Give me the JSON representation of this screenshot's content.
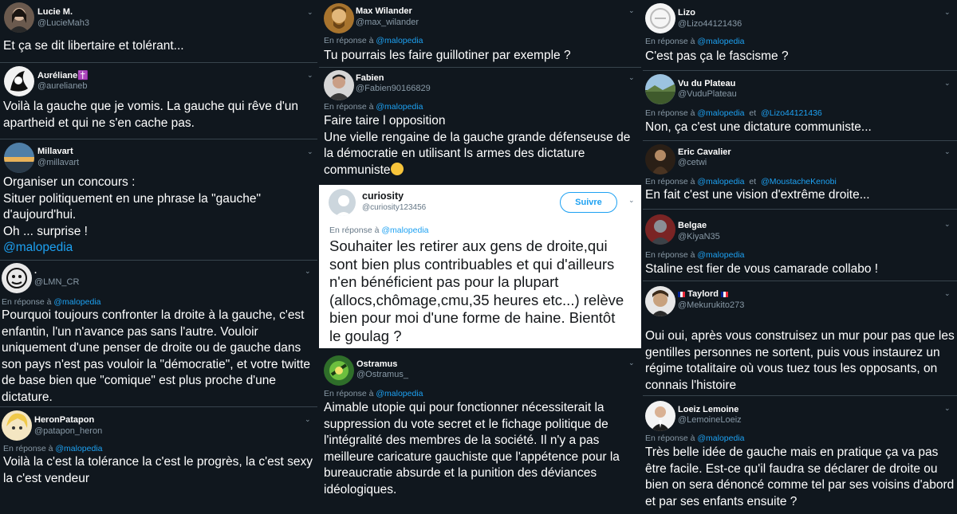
{
  "tweets": {
    "lucie": {
      "name": "Lucie M.",
      "handle": "@LucieMah3",
      "text": "Et ça se dit libertaire et tolérant..."
    },
    "aureliane": {
      "name": "Aʊréliane✝️",
      "handle": "@aurelianeb",
      "text": "Voilà la gauche que je vomis. La gauche qui rêve d'un apartheid et qui ne s'en cache pas."
    },
    "millavart": {
      "name": "Millavart",
      "handle": "@millavart",
      "lines": [
        "Organiser un concours :",
        "Situer politiquement en une phrase la \"gauche\"",
        "d'aujourd'hui.",
        "Oh ... surprise !"
      ],
      "link": "@malopedia"
    },
    "lmn": {
      "name": ".",
      "handle": "@LMN_CR",
      "reply_prefix": "En réponse à",
      "reply_mention": "@malopedia",
      "text": "Pourquoi toujours confronter la droite à la gauche, c'est enfantin, l'un n'avance pas sans l'autre. Vouloir uniquement d'une penser de droite ou de gauche dans son pays n'est pas vouloir la \"démocratie\", et votre twitte de base bien que \"comique\" est plus proche d'une dictature."
    },
    "heron": {
      "name": "HeronPatapon",
      "handle": "@patapon_heron",
      "reply_prefix": "En réponse à",
      "reply_mention": "@malopedia",
      "text": "Voilà la c'est la tolérance la c'est le progrès, la c'est sexy la c'est vendeur"
    },
    "max": {
      "name": "Max Wilander",
      "handle": "@max_wilander",
      "reply_prefix": "En réponse à",
      "reply_mention": "@malopedia",
      "text": "Tu pourrais les faire guillotiner par exemple ?"
    },
    "fabien": {
      "name": "Fabien",
      "handle": "@Fabien90166829",
      "reply_prefix": "En réponse à",
      "reply_mention": "@malopedia",
      "lines": [
        "Faire taire l opposition",
        "Une vielle rengaine de la gauche grande défenseuse de la démocratie en utilisant ls armes des dictature communiste"
      ]
    },
    "curiosity": {
      "name": "curiosity",
      "handle": "@curiosity123456",
      "follow_label": "Suivre",
      "reply_prefix": "En réponse à",
      "reply_mention": "@malopedia",
      "text": "Souhaiter les  retirer aux gens de droite,qui sont bien plus contribuables et qui d'ailleurs n'en bénéficient pas pour la plupart (allocs,chômage,cmu,35 heures etc...) relève bien pour moi d'une forme de haine. Bientôt le goulag ?"
    },
    "ostramus": {
      "name": "Ostramus",
      "handle": "@Ostramus_",
      "reply_prefix": "En réponse à",
      "reply_mention": "@malopedia",
      "text": "Aimable utopie qui pour fonctionner nécessiterait la suppression du vote secret et le fichage politique de l'intégralité des membres de la société. Il n'y a pas meilleure caricature gauchiste que l'appétence pour la bureaucratie absurde et la punition des déviances idéologiques."
    },
    "lizo": {
      "name": "Lizo",
      "handle": "@Lizo44121436",
      "reply_prefix": "En réponse à",
      "reply_mention": "@malopedia",
      "text": "C'est pas ça le fascisme ?"
    },
    "vudu": {
      "name": "Vu du Plateau",
      "handle": "@VuduPlateau",
      "reply_prefix": "En réponse à",
      "reply_mention": "@malopedia",
      "reply_joiner": "et",
      "reply_mention2": "@Lizo44121436",
      "text": "Non, ça c'est une dictature communiste..."
    },
    "eric": {
      "name": "Eric Cavalier",
      "handle": "@cetwi",
      "reply_prefix": "En réponse à",
      "reply_mention": "@malopedia",
      "reply_joiner": "et",
      "reply_mention2": "@MoustacheKenobi",
      "text": "En fait c'est une vision d'extrême droite..."
    },
    "belgae": {
      "name": "Belgae",
      "handle": "@KiyaN35",
      "reply_prefix": "En réponse à",
      "reply_mention": "@malopedia",
      "text": "Staline est fier de vous camarade collabo !"
    },
    "taylord": {
      "name": "Taylord",
      "handle": "@Mekurukito273",
      "text": "Oui oui, après vous construisez un mur pour pas que les gentilles personnes ne sortent, puis vous instaurez un régime totalitaire où vous tuez tous les opposants, on connais l'histoire"
    },
    "loeiz": {
      "name": "Loeiz Lemoine",
      "handle": "@LemoineLoeiz",
      "reply_prefix": "En réponse à",
      "reply_mention": "@malopedia",
      "text": "Très belle idée de gauche mais en pratique ça va pas être facile. Est-ce qu'il faudra se déclarer de droite ou bien on sera dénoncé comme tel par ses voisins d'abord et par ses enfants ensuite ?"
    }
  },
  "colors": {
    "background": "#10171e",
    "link": "#1da1f2",
    "muted": "#8899a6"
  }
}
